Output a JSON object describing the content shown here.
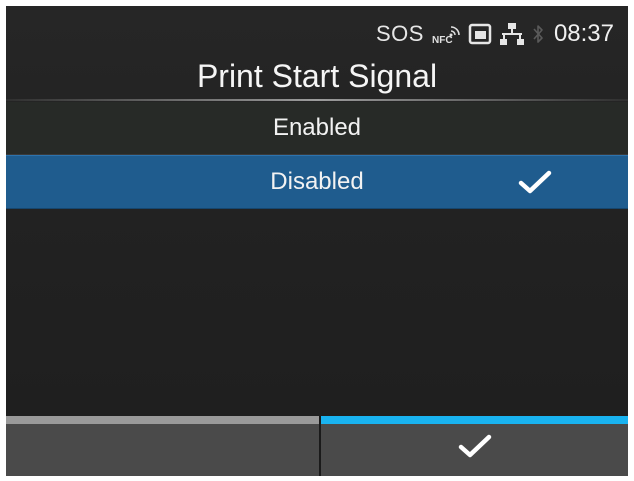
{
  "status_bar": {
    "sos_label": "SOS",
    "nfc_label": "NFC",
    "icons": [
      "nfc-icon",
      "sd-card-icon",
      "network-icon",
      "bluetooth-icon"
    ],
    "time": "08:37"
  },
  "screen": {
    "title": "Print Start Signal"
  },
  "options": [
    {
      "label": "Enabled",
      "selected": false
    },
    {
      "label": "Disabled",
      "selected": true
    }
  ],
  "softkeys": {
    "left": {
      "label": "",
      "strip_color": "#9a9a9a"
    },
    "right": {
      "icon": "checkmark-icon",
      "strip_color": "#19b3f0"
    }
  },
  "colors": {
    "selected_row": "#1f5c8e",
    "accent": "#19b3f0",
    "background": "#222222"
  }
}
